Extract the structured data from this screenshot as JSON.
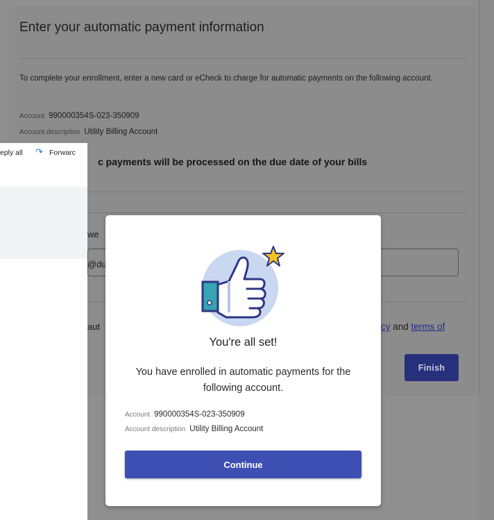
{
  "page": {
    "title": "Enter your automatic payment information",
    "intro": "To complete your enrollment, enter a new card or eCheck to charge for automatic payments on the following account.",
    "account_label": "Account",
    "account_value": "990000354S-023-350909",
    "desc_label": "Account description",
    "desc_value": "Utility Billing Account",
    "note_partial": "c payments will be processed on the due date of your bills",
    "email_label_partial": "we",
    "email_value_partial": "@du",
    "terms_prefix_partial": "aut",
    "terms_link1_partial": "cy",
    "terms_and": "and",
    "terms_link2": "terms of",
    "finish_label": "Finish"
  },
  "mail": {
    "reply_all_partial": "eply all",
    "forward_icon": "forward-arrow-icon",
    "forward_partial": "Forwarc"
  },
  "modal": {
    "title": "You're all set!",
    "body": "You have enrolled in automatic payments for the following account.",
    "account_label": "Account",
    "account_value": "990000354S-023-350909",
    "desc_label": "Account description",
    "desc_value": "Utility Billing Account",
    "continue_label": "Continue",
    "illustration_icon": "thumbs-up-star-icon",
    "colors": {
      "accent": "#3e4fb4",
      "circle": "#c9d7f1",
      "star": "#f5c023",
      "cuff": "#37a3b3",
      "outline": "#2b3784"
    }
  }
}
